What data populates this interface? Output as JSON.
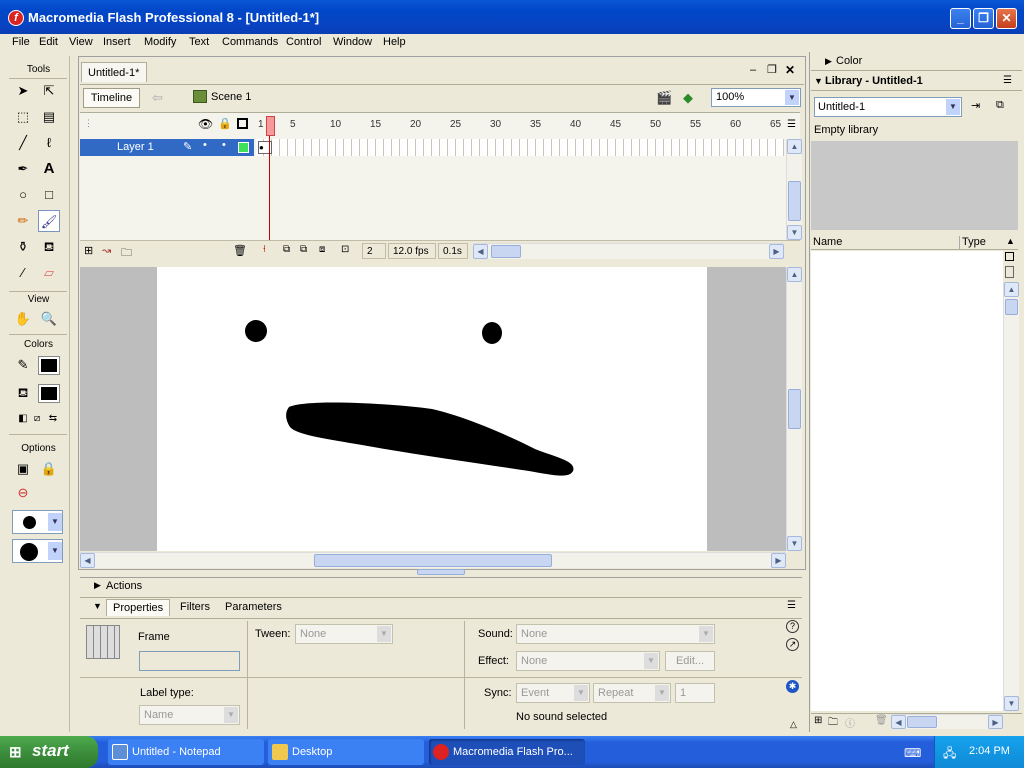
{
  "window": {
    "title": "Macromedia Flash Professional 8 - [Untitled-1*]",
    "app_icon_letter": "f",
    "controls": [
      "minimize",
      "maximize",
      "close"
    ]
  },
  "menu": [
    "File",
    "Edit",
    "View",
    "Insert",
    "Modify",
    "Text",
    "Commands",
    "Control",
    "Window",
    "Help"
  ],
  "tools": {
    "title": "Tools",
    "view_label": "View",
    "colors_label": "Colors",
    "options_label": "Options"
  },
  "document": {
    "tab": "Untitled-1*",
    "timeline_button": "Timeline",
    "scene": "Scene 1",
    "zoom": "100%",
    "layer_name": "Layer 1",
    "frame_numbers": [
      "1",
      "5",
      "10",
      "15",
      "20",
      "25",
      "30",
      "35",
      "40",
      "45",
      "50",
      "55",
      "60",
      "65"
    ],
    "current_frame": "2",
    "fps": "12.0 fps",
    "time": "0.1s"
  },
  "panels": {
    "actions": "Actions",
    "tabs": [
      "Properties",
      "Filters",
      "Parameters"
    ],
    "frame_label": "Frame",
    "label_type_label": "Label type:",
    "label_type_value": "Name",
    "tween_label": "Tween:",
    "tween_value": "None",
    "sound_label": "Sound:",
    "sound_value": "None",
    "effect_label": "Effect:",
    "effect_value": "None",
    "edit_button": "Edit...",
    "sync_label": "Sync:",
    "sync_value": "Event",
    "repeat_value": "Repeat",
    "repeat_count": "1",
    "sound_status": "No sound selected"
  },
  "right": {
    "color_panel": "Color",
    "library_panel": "Library - Untitled-1",
    "library_select": "Untitled-1",
    "empty_text": "Empty library",
    "col_name": "Name",
    "col_type": "Type"
  },
  "taskbar": {
    "start": "start",
    "tasks": [
      "Untitled - Notepad",
      "Desktop",
      "Macromedia Flash Pro..."
    ],
    "clock": "2:04 PM"
  }
}
